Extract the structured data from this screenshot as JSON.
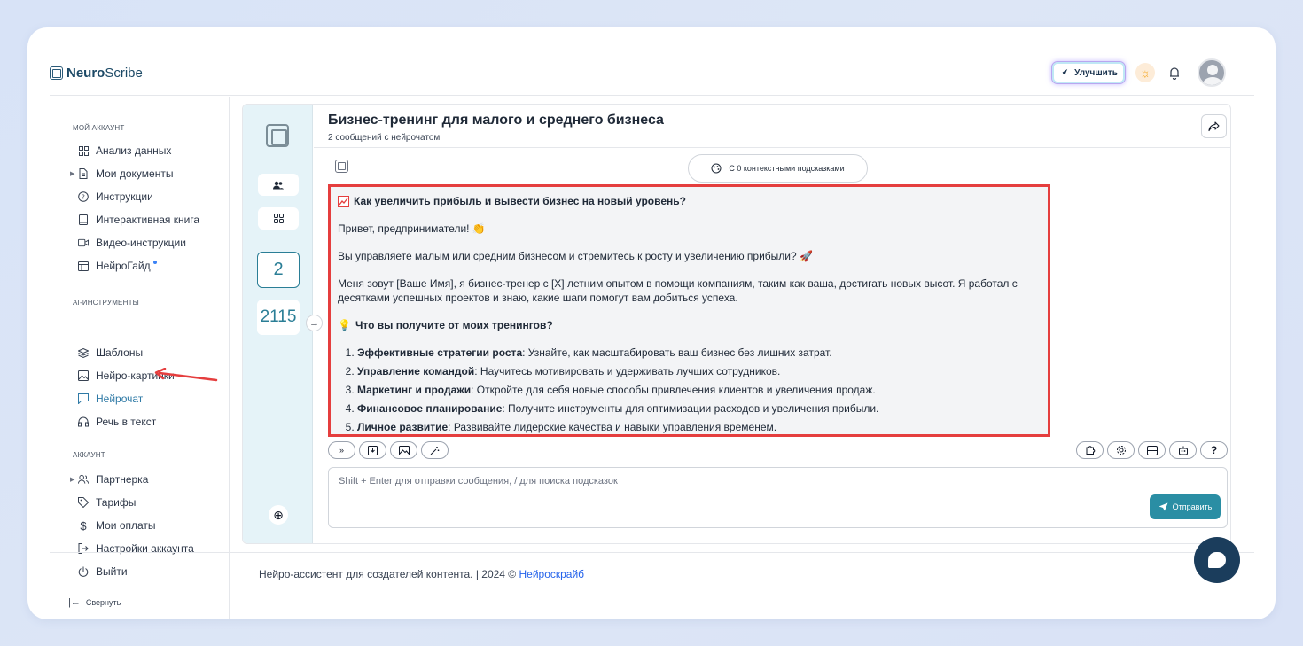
{
  "brand": {
    "name_bold": "Neuro",
    "name_rest": "Scribe"
  },
  "header": {
    "upgrade_label": "Улучшить"
  },
  "sidebar": {
    "section_account": "МОЙ АККАУНТ",
    "account_items": [
      {
        "label": "Анализ данных",
        "icon": "grid-icon"
      },
      {
        "label": "Мои документы",
        "icon": "document-icon"
      },
      {
        "label": "Инструкции",
        "icon": "help-icon"
      },
      {
        "label": "Интерактивная книга",
        "icon": "book-icon"
      },
      {
        "label": "Видео-инструкции",
        "icon": "video-icon"
      },
      {
        "label": "НейроГайд",
        "icon": "guide-icon"
      }
    ],
    "section_ai": "AI-ИНСТРУМЕНТЫ",
    "ai_items": [
      {
        "label": "Шаблоны",
        "icon": "layers-icon"
      },
      {
        "label": "Нейро-картинки",
        "icon": "image-icon"
      },
      {
        "label": "Нейрочат",
        "icon": "chat-icon"
      },
      {
        "label": "Речь в текст",
        "icon": "headphones-icon"
      }
    ],
    "section_acc": "АККАУНТ",
    "acc_items": [
      {
        "label": "Партнерка",
        "icon": "users-icon"
      },
      {
        "label": "Тарифы",
        "icon": "tag-icon"
      },
      {
        "label": "Мои оплаты",
        "icon": "dollar-icon"
      },
      {
        "label": "Настройки аккаунта",
        "icon": "settings-icon"
      },
      {
        "label": "Выйти",
        "icon": "power-icon"
      }
    ],
    "collapse_label": "Свернуть"
  },
  "rail": {
    "count_primary": "2",
    "count_secondary": "2115"
  },
  "chat": {
    "title": "Бизнес-тренинг для малого и среднего бизнеса",
    "subtitle": "2 сообщений с нейрочатом",
    "context_label": "С 0 контекстными подсказками",
    "message": {
      "heading1": "Как увеличить прибыль и вывести бизнес на новый уровень?",
      "greeting": "Привет, предприниматели! 👏",
      "intro": "Вы управляете малым или средним бизнесом и стремитесь к росту и увеличению прибыли? 🚀",
      "bio": "Меня зовут [Ваше Имя], я бизнес-тренер с [X] летним опытом в помощи компаниям, таким как ваша, достигать новых высот. Я работал с десятками успешных проектов и знаю, какие шаги помогут вам добиться успеха.",
      "heading2": "Что вы получите от моих тренингов?",
      "list": [
        {
          "bold": "Эффективные стратегии роста",
          "text": ": Узнайте, как масштабировать ваш бизнес без лишних затрат."
        },
        {
          "bold": "Управление командой",
          "text": ": Научитесь мотивировать и удерживать лучших сотрудников."
        },
        {
          "bold": "Маркетинг и продажи",
          "text": ": Откройте для себя новые способы привлечения клиентов и увеличения продаж."
        },
        {
          "bold": "Финансовое планирование",
          "text": ": Получите инструменты для оптимизации расходов и увеличения прибыли."
        },
        {
          "bold": "Личное развитие",
          "text": ": Развивайте лидерские качества и навыки управления временем."
        }
      ]
    },
    "input_placeholder": "Shift + Enter для отправки сообщения, / для поиска подсказок",
    "send_label": "Отправить",
    "help_label": "?"
  },
  "footer": {
    "text": "Нейро-ассистент для создателей контента.  | 2024 © ",
    "link": "Нейроскрайб"
  },
  "colors": {
    "accent": "#2a8ea4",
    "highlight": "#e53e3e",
    "active_nav": "#2f7aa6"
  }
}
